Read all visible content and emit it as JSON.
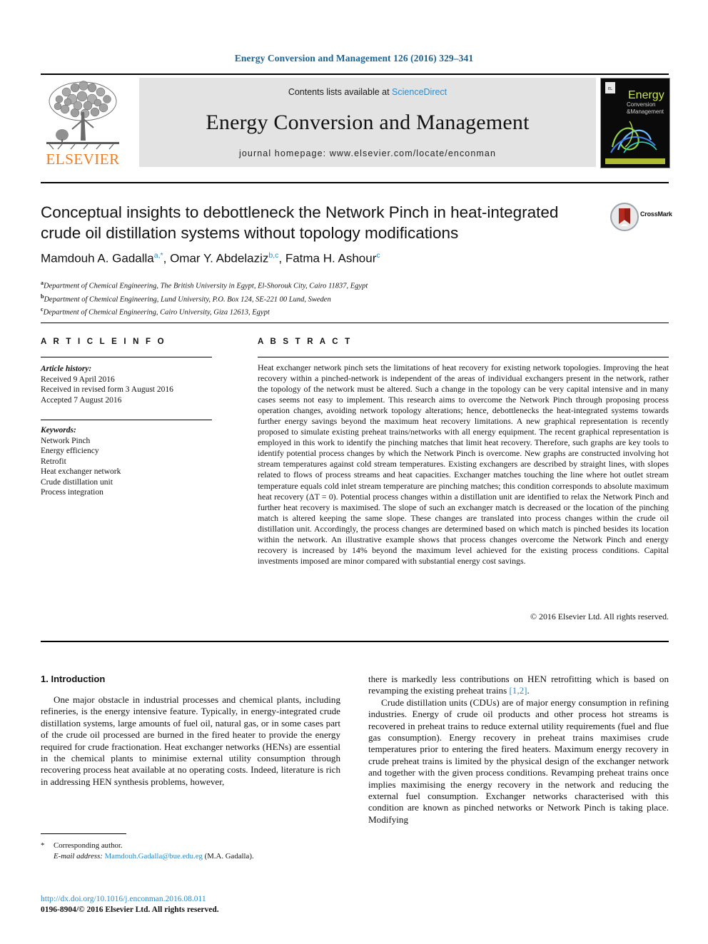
{
  "running_head": "Energy Conversion and Management 126 (2016) 329–341",
  "masthead": {
    "contents_prefix": "Contents lists available at ",
    "sciencedirect": "ScienceDirect",
    "journal_name": "Energy Conversion and Management",
    "homepage": "journal homepage: www.elsevier.com/locate/enconman",
    "publisher": "ELSEVIER",
    "cover_title_line1": "Energy",
    "cover_title_line2": "Conversion",
    "cover_title_line3": "Management",
    "cover_amp": "&"
  },
  "article": {
    "title": "Conceptual insights to debottleneck the Network Pinch in heat-integrated crude oil distillation systems without topology modifications",
    "crossmark_label": "CrossMark",
    "authors": [
      {
        "name": "Mamdouh A. Gadalla",
        "marks": "a,*"
      },
      {
        "name": "Omar Y. Abdelaziz",
        "marks": "b,c"
      },
      {
        "name": "Fatma H. Ashour",
        "marks": "c"
      }
    ],
    "affiliations": [
      {
        "mark": "a",
        "text": "Department of Chemical Engineering, The British University in Egypt, El-Shorouk City, Cairo 11837, Egypt"
      },
      {
        "mark": "b",
        "text": "Department of Chemical Engineering, Lund University, P.O. Box 124, SE-221 00 Lund, Sweden"
      },
      {
        "mark": "c",
        "text": "Department of Chemical Engineering, Cairo University, Giza 12613, Egypt"
      }
    ]
  },
  "article_info": {
    "heading": "A R T I C L E    I N F O",
    "history_label": "Article history:",
    "history": [
      "Received 9 April 2016",
      "Received in revised form 3 August 2016",
      "Accepted 7 August 2016"
    ],
    "keywords_label": "Keywords:",
    "keywords": [
      "Network Pinch",
      "Energy efficiency",
      "Retrofit",
      "Heat exchanger network",
      "Crude distillation unit",
      "Process integration"
    ]
  },
  "abstract": {
    "heading": "A B S T R A C T",
    "text": "Heat exchanger network pinch sets the limitations of heat recovery for existing network topologies. Improving the heat recovery within a pinched-network is independent of the areas of individual exchangers present in the network, rather the topology of the network must be altered. Such a change in the topology can be very capital intensive and in many cases seems not easy to implement. This research aims to overcome the Network Pinch through proposing process operation changes, avoiding network topology alterations; hence, debottlenecks the heat-integrated systems towards further energy savings beyond the maximum heat recovery limitations. A new graphical representation is recently proposed to simulate existing preheat trains/networks with all energy equipment. The recent graphical representation is employed in this work to identify the pinching matches that limit heat recovery. Therefore, such graphs are key tools to identify potential process changes by which the Network Pinch is overcome. New graphs are constructed involving hot stream temperatures against cold stream temperatures. Existing exchangers are described by straight lines, with slopes related to flows of process streams and heat capacities. Exchanger matches touching the line where hot outlet stream temperature equals cold inlet stream temperature are pinching matches; this condition corresponds to absolute maximum heat recovery (ΔT = 0). Potential process changes within a distillation unit are identified to relax the Network Pinch and further heat recovery is maximised. The slope of such an exchanger match is decreased or the location of the pinching match is altered keeping the same slope. These changes are translated into process changes within the crude oil distillation unit. Accordingly, the process changes are determined based on which match is pinched besides its location within the network. An illustrative example shows that process changes overcome the Network Pinch and energy recovery is increased by 14% beyond the maximum level achieved for the existing process conditions. Capital investments imposed are minor compared with substantial energy cost savings.",
    "copyright": "© 2016 Elsevier Ltd. All rights reserved."
  },
  "body": {
    "section_title": "1. Introduction",
    "left_para_1": "One major obstacle in industrial processes and chemical plants, including refineries, is the energy intensive feature. Typically, in energy-integrated crude distillation systems, large amounts of fuel oil, natural gas, or in some cases part of the crude oil processed are burned in the fired heater to provide the energy required for crude fractionation. Heat exchanger networks (HENs) are essential in the chemical plants to minimise external utility consumption through recovering process heat available at no operating costs. Indeed, literature is rich in addressing HEN synthesis problems, however,",
    "right_para_1_a": "there is markedly less contributions on HEN retrofitting which is based on revamping the existing preheat trains ",
    "right_para_1_cite": "[1,2]",
    "right_para_1_b": ".",
    "right_para_2": "Crude distillation units (CDUs) are of major energy consumption in refining industries. Energy of crude oil products and other process hot streams is recovered in preheat trains to reduce external utility requirements (fuel and flue gas consumption). Energy recovery in preheat trains maximises crude temperatures prior to entering the fired heaters. Maximum energy recovery in crude preheat trains is limited by the physical design of the exchanger network and together with the given process conditions. Revamping preheat trains once implies maximising the energy recovery in the network and reducing the external fuel consumption. Exchanger networks characterised with this condition are known as pinched networks or Network Pinch is taking place. Modifying"
  },
  "footer": {
    "corresponding_marker": "*",
    "corresponding_text": "Corresponding author.",
    "email_label": "E-mail address:",
    "email": "Mamdouh.Gadalla@bue.edu.eg",
    "email_owner": "(M.A. Gadalla).",
    "doi": "http://dx.doi.org/10.1016/j.enconman.2016.08.011",
    "issn_line": "0196-8904/© 2016 Elsevier Ltd. All rights reserved."
  },
  "colors": {
    "link": "#2e8bc9",
    "elsevier_orange": "#f07c22",
    "banner_bg": "#e3e3e3"
  }
}
